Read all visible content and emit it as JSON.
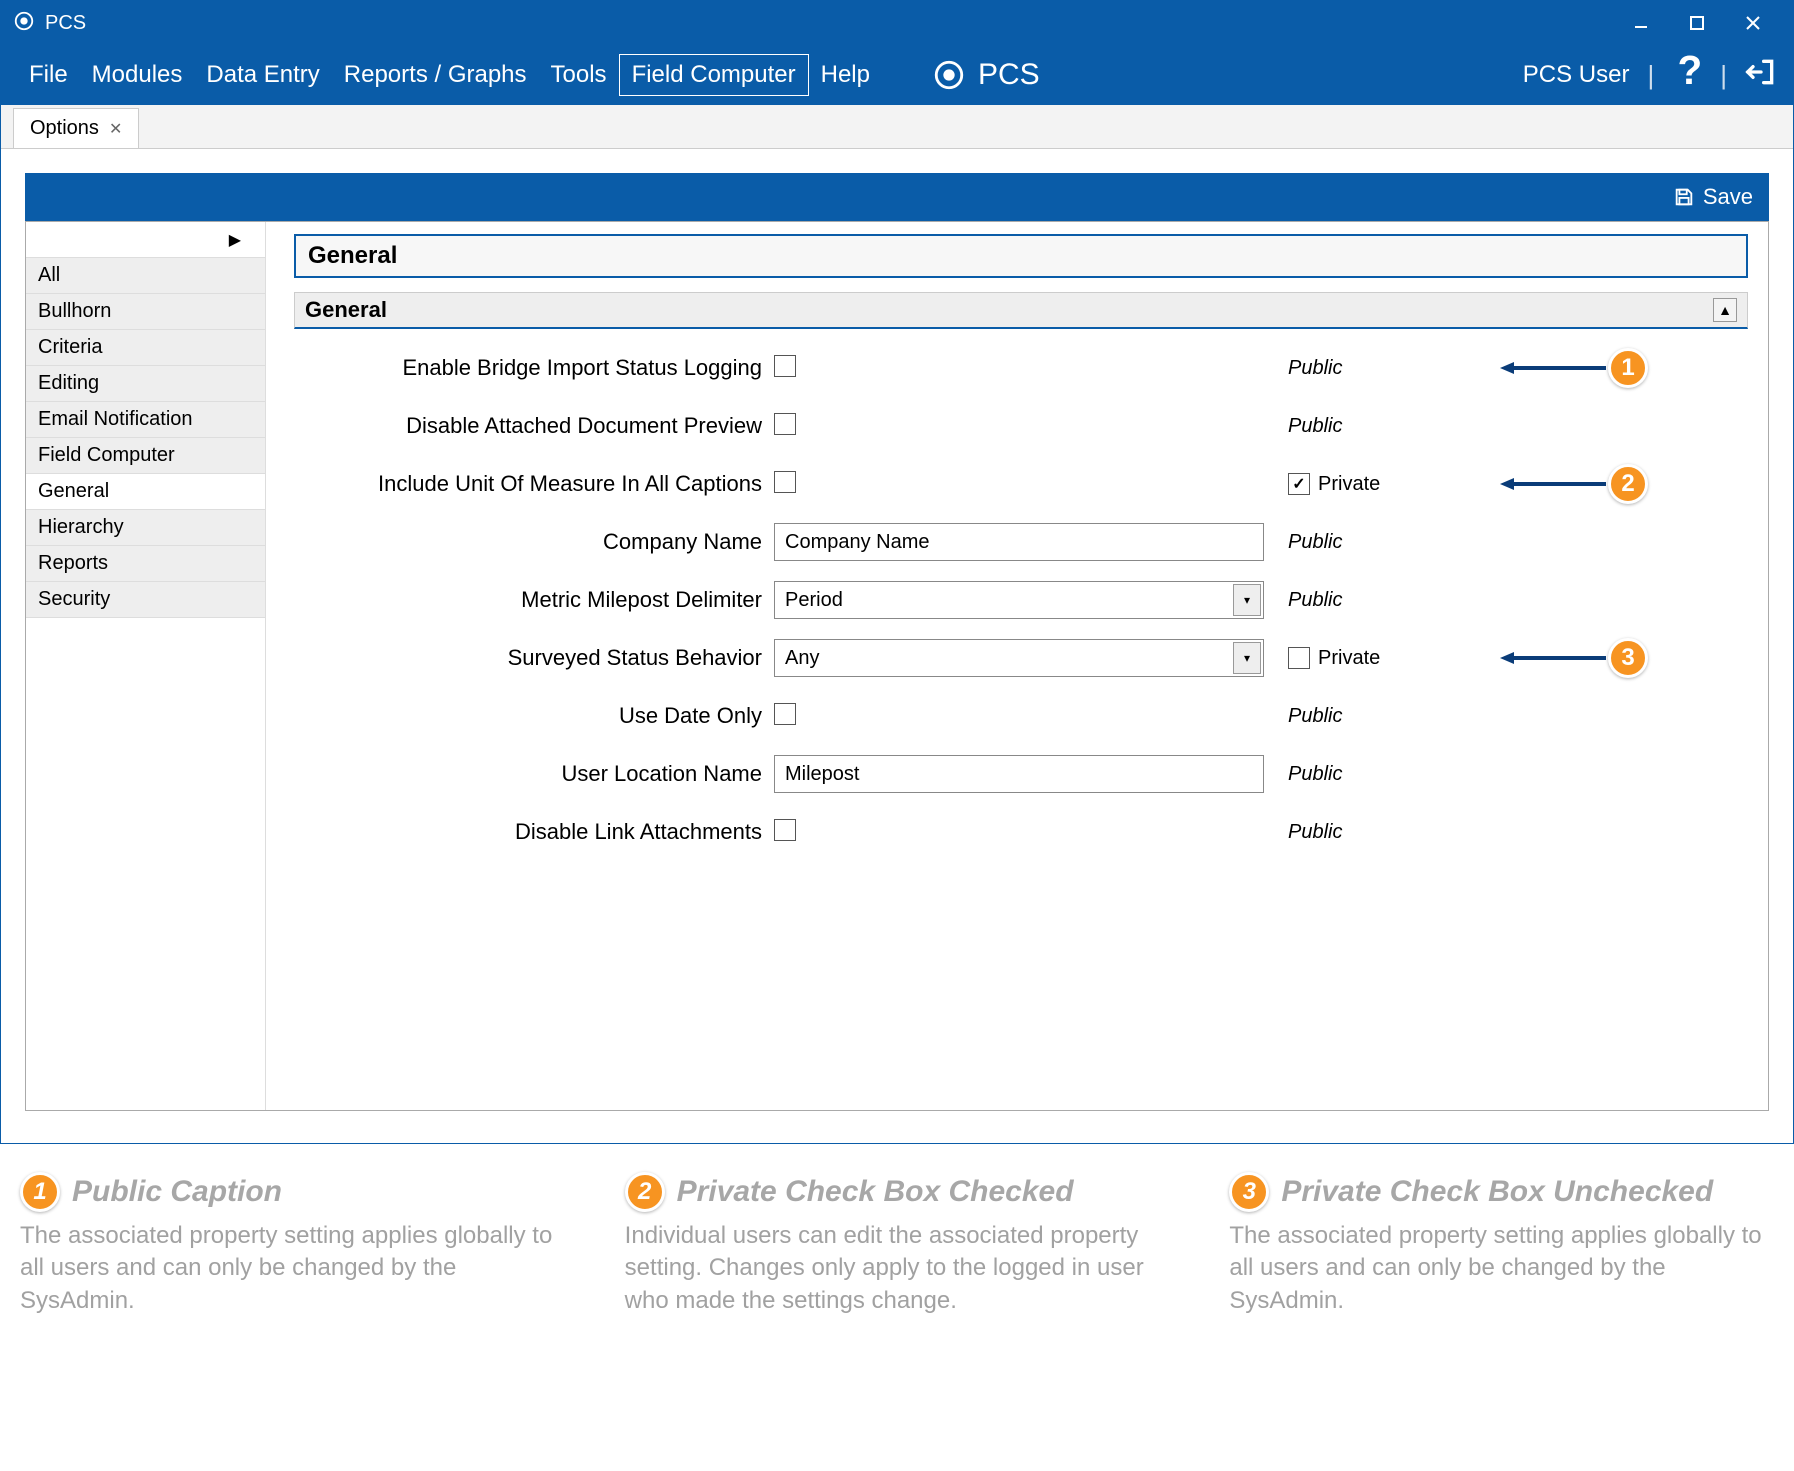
{
  "window": {
    "title": "PCS"
  },
  "menubar": {
    "items": [
      "File",
      "Modules",
      "Data Entry",
      "Reports / Graphs",
      "Tools",
      "Field Computer",
      "Help"
    ],
    "active": "Field Computer",
    "brand": "PCS",
    "user": "PCS User"
  },
  "tab": {
    "label": "Options"
  },
  "toolbar": {
    "save": "Save"
  },
  "sidebar": {
    "items": [
      "All",
      "Bullhorn",
      "Criteria",
      "Editing",
      "Email Notification",
      "Field Computer",
      "General",
      "Hierarchy",
      "Reports",
      "Security"
    ],
    "active": "General"
  },
  "panel": {
    "title": "General",
    "section": "General",
    "rows": [
      {
        "label": "Enable Bridge Import Status Logging",
        "type": "checkbox",
        "checked": false,
        "scope": "Public",
        "callout": 1
      },
      {
        "label": "Disable Attached Document Preview",
        "type": "checkbox",
        "checked": false,
        "scope": "Public"
      },
      {
        "label": "Include Unit Of Measure In All Captions",
        "type": "checkbox",
        "checked": false,
        "scope": "Private",
        "priv_checked": true,
        "callout": 2
      },
      {
        "label": "Company Name",
        "type": "text",
        "value": "Company Name",
        "scope": "Public"
      },
      {
        "label": "Metric Milepost Delimiter",
        "type": "select",
        "value": "Period",
        "scope": "Public"
      },
      {
        "label": "Surveyed Status Behavior",
        "type": "select",
        "value": "Any",
        "scope": "Private",
        "priv_checked": false,
        "callout": 3
      },
      {
        "label": "Use Date Only",
        "type": "checkbox",
        "checked": false,
        "scope": "Public"
      },
      {
        "label": "User Location Name",
        "type": "text",
        "value": "Milepost",
        "scope": "Public"
      },
      {
        "label": "Disable Link Attachments",
        "type": "checkbox",
        "checked": false,
        "scope": "Public"
      }
    ]
  },
  "legend": [
    {
      "n": "1",
      "title": "Public Caption",
      "body": "The associated property setting applies globally to all users and can only be changed by the SysAdmin."
    },
    {
      "n": "2",
      "title": "Private Check Box Checked",
      "body": "Individual users can edit the associated property setting. Changes only apply to the logged in user who made the settings change."
    },
    {
      "n": "3",
      "title": "Private Check Box Unchecked",
      "body": "The associated property setting applies globally to all users and can only be changed by the SysAdmin."
    }
  ]
}
